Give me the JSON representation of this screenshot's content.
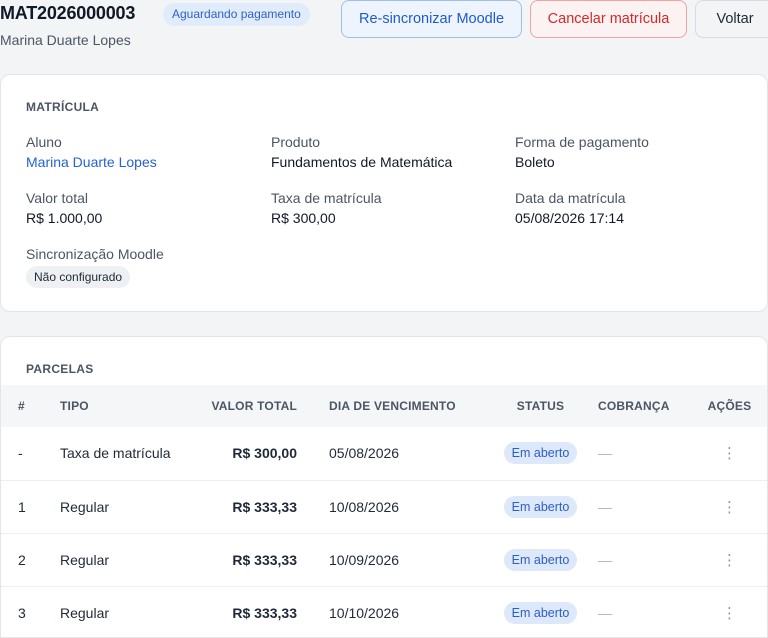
{
  "header": {
    "enrollment_id": "MAT2026000003",
    "status_badge": "Aguardando pagamento",
    "student_name": "Marina Duarte Lopes",
    "buttons": {
      "resync": "Re-sincronizar Moodle",
      "cancel": "Cancelar matrícula",
      "back": "Voltar"
    }
  },
  "enrollment": {
    "section_title": "MATRÍCULA",
    "student": {
      "label": "Aluno",
      "value": "Marina Duarte Lopes"
    },
    "product": {
      "label": "Produto",
      "value": "Fundamentos de Matemática"
    },
    "payment_method": {
      "label": "Forma de pagamento",
      "value": "Boleto"
    },
    "total": {
      "label": "Valor total",
      "value": "R$ 1.000,00"
    },
    "fee": {
      "label": "Taxa de matrícula",
      "value": "R$ 300,00"
    },
    "date": {
      "label": "Data da matrícula",
      "value": "05/08/2026 17:14"
    },
    "moodle": {
      "label": "Sincronização Moodle",
      "value": "Não configurado"
    }
  },
  "installments": {
    "section_title": "PARCELAS",
    "columns": [
      "#",
      "TIPO",
      "VALOR TOTAL",
      "DIA DE VENCIMENTO",
      "STATUS",
      "COBRANÇA",
      "AÇÕES"
    ],
    "rows": [
      {
        "num": "-",
        "type": "Taxa de matrícula",
        "amount": "R$ 300,00",
        "due": "05/08/2026",
        "status": "Em aberto",
        "charge": "—",
        "actions": "⋮"
      },
      {
        "num": "1",
        "type": "Regular",
        "amount": "R$ 333,33",
        "due": "10/08/2026",
        "status": "Em aberto",
        "charge": "—",
        "actions": "⋮"
      },
      {
        "num": "2",
        "type": "Regular",
        "amount": "R$ 333,33",
        "due": "10/09/2026",
        "status": "Em aberto",
        "charge": "—",
        "actions": "⋮"
      },
      {
        "num": "3",
        "type": "Regular",
        "amount": "R$ 333,33",
        "due": "10/10/2026",
        "status": "Em aberto",
        "charge": "—",
        "actions": "⋮"
      }
    ]
  },
  "colors": {
    "accent": "#2563cf",
    "danger": "#d02b2b",
    "status_open_bg": "#dde8fa",
    "background": "#f3f4f6"
  }
}
